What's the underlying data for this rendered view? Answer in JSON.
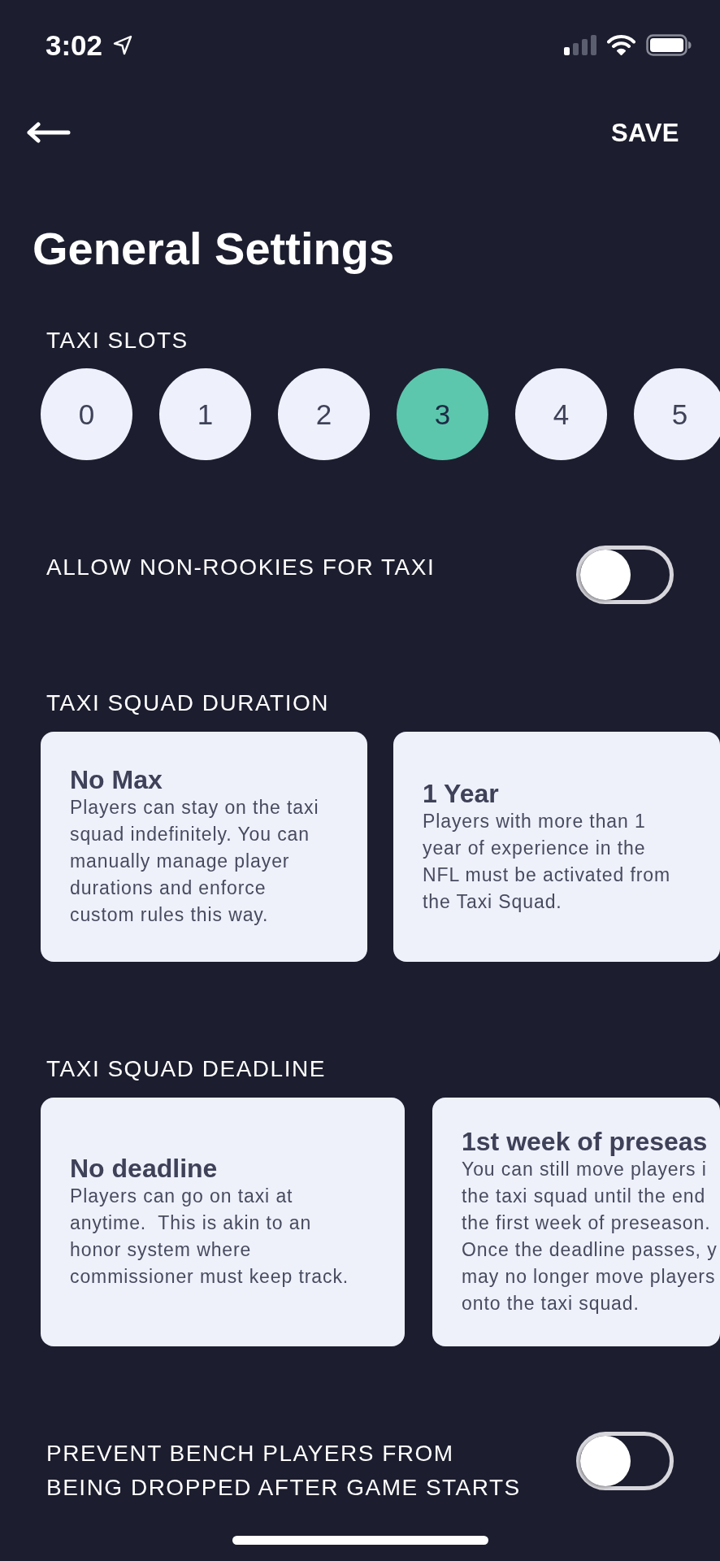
{
  "status_bar": {
    "time": "3:02"
  },
  "nav": {
    "save": "SAVE"
  },
  "title": "General Settings",
  "taxi_slots": {
    "label": "TAXI SLOTS",
    "options": [
      {
        "label": "0",
        "selected": false
      },
      {
        "label": "1",
        "selected": false
      },
      {
        "label": "2",
        "selected": false
      },
      {
        "label": "3",
        "selected": true
      },
      {
        "label": "4",
        "selected": false
      },
      {
        "label": "5",
        "selected": false
      }
    ]
  },
  "allow_non_rookies": {
    "label": "ALLOW NON-ROOKIES FOR TAXI",
    "on": false
  },
  "duration": {
    "label": "TAXI SQUAD DURATION",
    "options": [
      {
        "title": "No Max",
        "lines": [
          "Players can stay on the taxi",
          "squad indefinitely. You can",
          "manually manage player",
          "durations and enforce",
          "custom rules this way."
        ]
      },
      {
        "title": "1 Year",
        "lines": [
          "Players with more than 1",
          "year of experience in the",
          "NFL must be activated from",
          "the Taxi Squad."
        ]
      }
    ]
  },
  "deadline": {
    "label": "TAXI SQUAD DEADLINE",
    "options": [
      {
        "title": "No deadline",
        "lines": [
          "Players can go on taxi at",
          "anytime.  This is akin to an",
          "honor system where",
          "commissioner must keep track."
        ]
      },
      {
        "title": "1st week of preseas",
        "lines": [
          "You can still move players i",
          "the taxi squad until the end",
          "the first week of preseason.",
          "Once the deadline passes, y",
          "may no longer move players",
          "onto the taxi squad."
        ]
      }
    ]
  },
  "prevent_bench_drop": {
    "label_lines": [
      "PREVENT BENCH PLAYERS FROM",
      "BEING DROPPED AFTER GAME STARTS"
    ],
    "on": false
  }
}
